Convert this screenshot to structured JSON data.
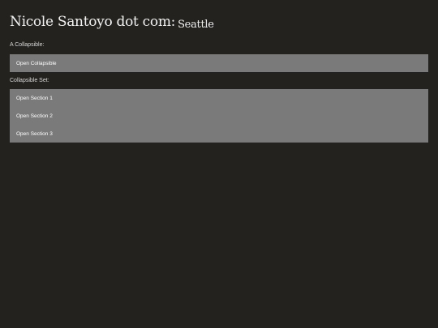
{
  "header": {
    "title": "Nicole Santoyo dot com:",
    "subtitle": "Seattle"
  },
  "collapsible": {
    "label": "A Collapsible:",
    "button_label": "Open Collapsible"
  },
  "collapsible_set": {
    "label": "Collapsible Set:",
    "sections": [
      {
        "label": "Open Section 1"
      },
      {
        "label": "Open Section 2"
      },
      {
        "label": "Open Section 3"
      }
    ]
  },
  "colors": {
    "background": "#23221f",
    "panel": "#7a7a7a",
    "text": "#ffffff"
  }
}
